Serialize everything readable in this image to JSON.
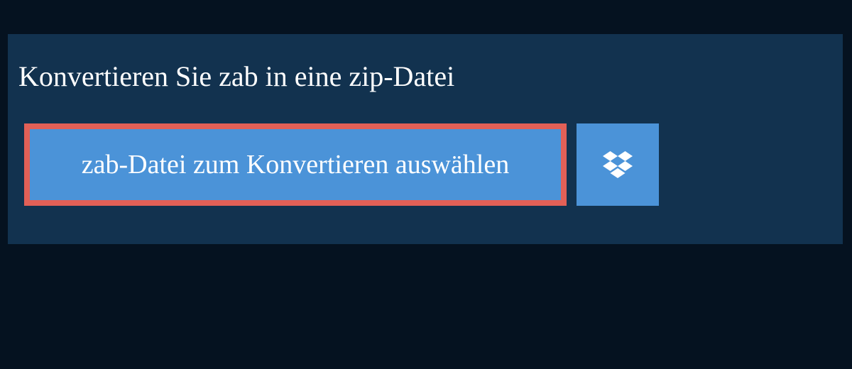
{
  "heading": "Konvertieren Sie zab in eine zip-Datei",
  "select_button_label": "zab-Datei zum Konvertieren auswählen",
  "colors": {
    "page_bg": "#051220",
    "panel_bg": "#12324f",
    "button_bg": "#4b93d8",
    "button_border": "#e26057",
    "text": "#ffffff"
  }
}
